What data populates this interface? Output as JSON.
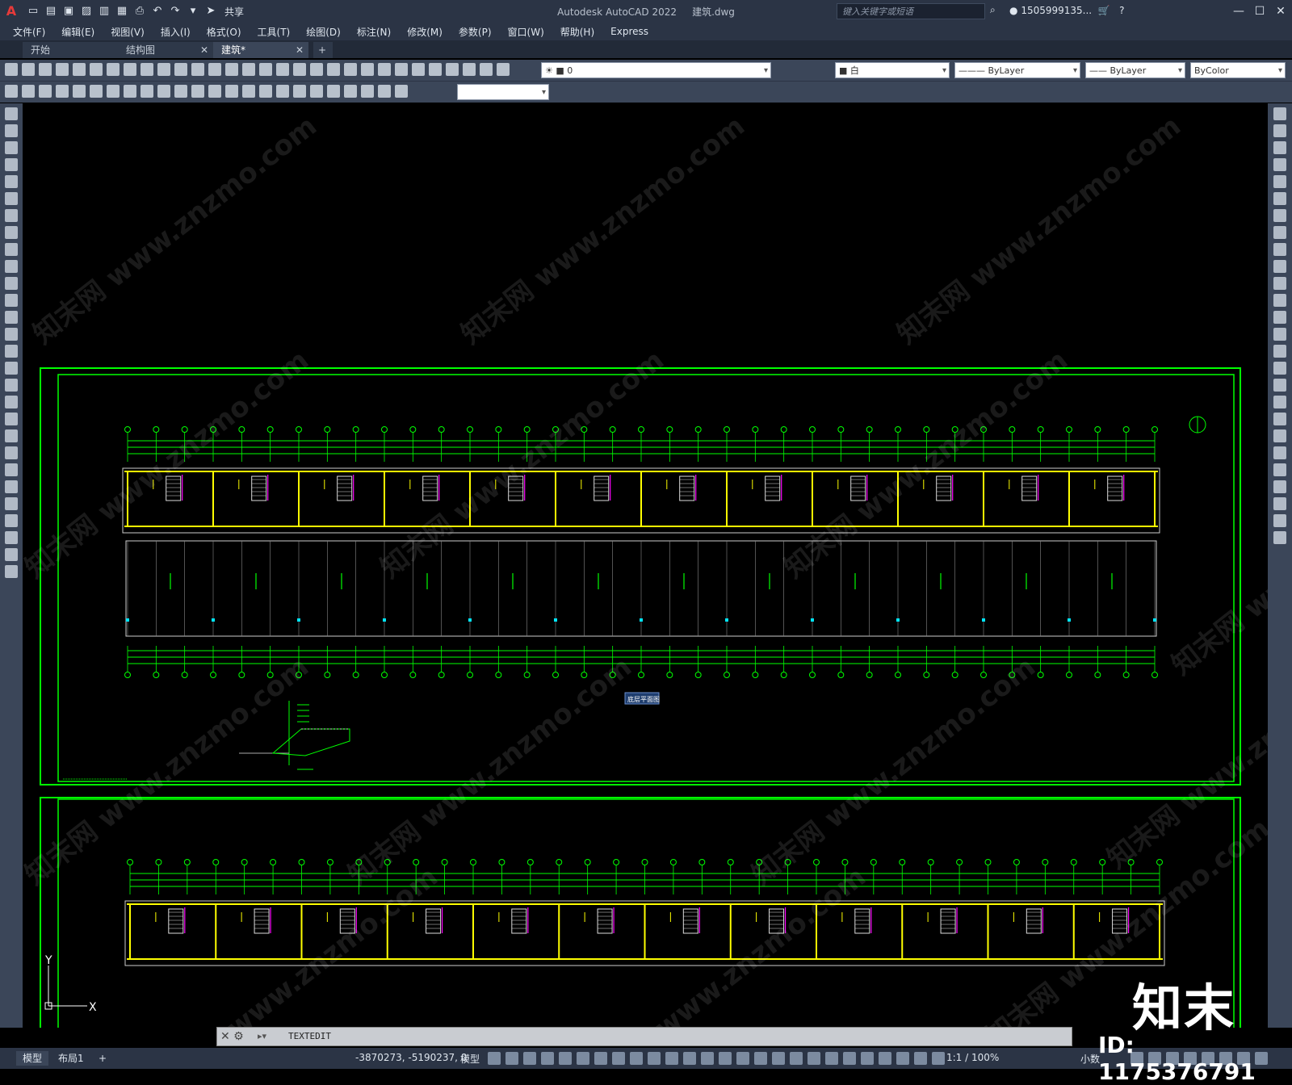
{
  "window": {
    "app_title": "Autodesk AutoCAD 2022",
    "file_name": "建筑.dwg",
    "share_label": "共享",
    "search_placeholder": "键入关键字或短语",
    "user": "1505999135...",
    "minimize": "—",
    "maximize": "☐",
    "close": "✕"
  },
  "menu": {
    "items": [
      "文件(F)",
      "编辑(E)",
      "视图(V)",
      "插入(I)",
      "格式(O)",
      "工具(T)",
      "绘图(D)",
      "标注(N)",
      "修改(M)",
      "参数(P)",
      "窗口(W)",
      "帮助(H)",
      "Express"
    ]
  },
  "tabs": [
    {
      "label": "开始"
    },
    {
      "label": "结构图"
    },
    {
      "label": "建筑*"
    }
  ],
  "tab_add": "+",
  "properties": {
    "layer": "0",
    "color": "白",
    "linetype": "ByLayer",
    "lineweight": "ByLayer",
    "plotstyle": "ByColor"
  },
  "drawing": {
    "plan_title": "底层平面图"
  },
  "command_line": {
    "text": "TEXTEDIT"
  },
  "status": {
    "tab_model": "模型",
    "tab_layout": "布局1",
    "tab_add": "+",
    "coordinates": "-3870273, -5190237, 0",
    "model_label": "模型",
    "scale": "1:1 / 100%",
    "units": "小数"
  },
  "watermark": {
    "site": "知末网 www.znzmo.com",
    "brand": "知末",
    "id": "ID: 1175376791"
  },
  "ucs": {
    "x_label": "X",
    "y_label": "Y"
  }
}
